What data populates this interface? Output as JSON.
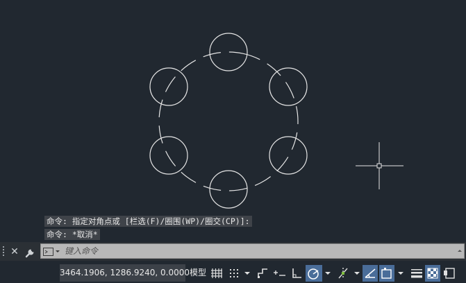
{
  "history": {
    "line1": "命令: 指定对角点或 [栏选(F)/圈围(WP)/圈交(CP)]:",
    "line2": "命令: *取消*"
  },
  "command": {
    "placeholder": "键入命令"
  },
  "status": {
    "coordinates": "3464.1906, 1286.9240, 0.0000",
    "model_label": "模型"
  },
  "colors": {
    "background": "#212830",
    "geometry": "#e6e6e6",
    "active_toggle": "#4a6d99"
  },
  "icons": {
    "close": "close-icon",
    "settings": "wrench-icon",
    "prompt": "command-prompt-icon",
    "status": [
      "grid-icon",
      "snap-icon",
      "infer-constraints-icon",
      "dynamic-input-icon",
      "ortho-icon",
      "polar-tracking-icon",
      "object-snap-tracking-icon",
      "dynamic-ucs-icon",
      "selection-cycling-icon",
      "lineweight-icon",
      "transparency-icon",
      "quick-properties-icon"
    ]
  }
}
